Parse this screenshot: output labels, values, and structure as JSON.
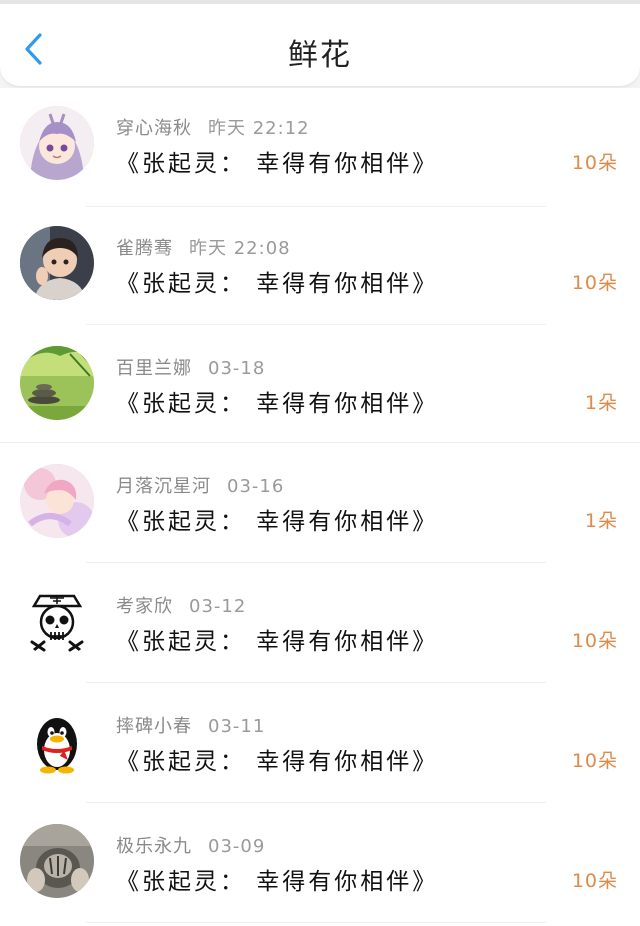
{
  "header": {
    "title": "鲜花"
  },
  "rows": [
    {
      "name": "穿心海秋",
      "time": "昨天 22:12",
      "gift": "《张起灵： 幸得有你相伴》",
      "count": "10朵"
    },
    {
      "name": "雀腾骞",
      "time": "昨天 22:08",
      "gift": "《张起灵： 幸得有你相伴》",
      "count": "10朵"
    },
    {
      "name": "百里兰娜",
      "time": "03-18",
      "gift": "《张起灵： 幸得有你相伴》",
      "count": "1朵"
    },
    {
      "name": "月落沉星河",
      "time": "03-16",
      "gift": "《张起灵： 幸得有你相伴》",
      "count": "1朵"
    },
    {
      "name": "考家欣",
      "time": "03-12",
      "gift": "《张起灵： 幸得有你相伴》",
      "count": "10朵"
    },
    {
      "name": "摔碑小春",
      "time": "03-11",
      "gift": "《张起灵： 幸得有你相伴》",
      "count": "10朵"
    },
    {
      "name": "极乐永九",
      "time": "03-09",
      "gift": "《张起灵： 幸得有你相伴》",
      "count": "10朵"
    }
  ],
  "icons": {
    "back": "chevron-left-icon"
  },
  "colors": {
    "accent_blue": "#2f9bf0",
    "count_orange": "#e08a49"
  }
}
